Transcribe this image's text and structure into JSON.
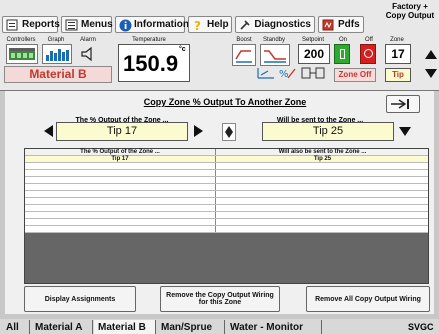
{
  "toolbar": {
    "reports": "Reports",
    "menus": "Menus",
    "information": "Information",
    "help": "Help",
    "diagnostics": "Diagnostics",
    "pdfs": "Pdfs",
    "factory": "Factory +",
    "copy_output": "Copy Output",
    "controllers": "Controllers",
    "graph": "Graph",
    "alarm": "Alarm",
    "temperature": "Temperature",
    "temp_value": "150.9",
    "temp_unit": "°c",
    "boost": "Boost",
    "standby": "Standby",
    "setpoint": "Setpoint",
    "setpoint_value": "200",
    "on": "On",
    "off": "Off",
    "zone": "Zone",
    "zone_value": "17",
    "zone_name": "Material B",
    "zone_off": "Zone Off",
    "tip": "Tip"
  },
  "panel": {
    "title": "Copy Zone % Output To Another Zone",
    "source_label": "The % Output of the Zone ...",
    "source_value": "Tip 17",
    "target_label": "Will be sent to the Zone ...",
    "target_value": "Tip 25"
  },
  "table": {
    "headers": [
      "The % Output of the Zone ...",
      "Will also be sent to the Zone ..."
    ],
    "rows": [
      [
        "Tip 17",
        "Tip 25"
      ]
    ]
  },
  "actions": {
    "display": "Display Assignments",
    "remove_zone": "Remove the Copy Output Wiring for this Zone",
    "remove_all": "Remove All Copy Output Wiring"
  },
  "tabs": [
    "All",
    "Material A",
    "Material B",
    "Man/Sprue",
    "Water - Monitor"
  ],
  "brand": "SVGC",
  "colors": {
    "accent": "#c0392b",
    "highlight": "#fbfbd0",
    "on": "#2eaa2e",
    "off": "#d62020"
  }
}
